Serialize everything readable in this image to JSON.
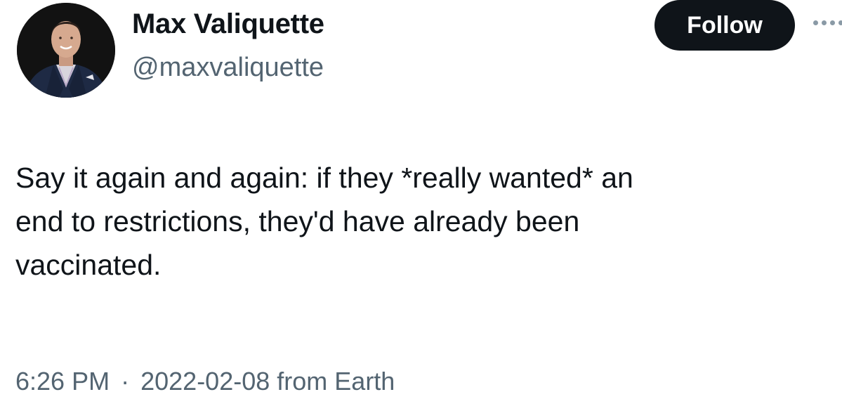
{
  "user": {
    "display_name": "Max Valiquette",
    "handle": "@maxvaliquette"
  },
  "actions": {
    "follow_label": "Follow",
    "more_icon": "more-horizontal-icon"
  },
  "tweet": {
    "text": "Say it again and again: if they *really wanted* an\nend to restrictions, they'd have already been\nvaccinated.",
    "time": "6:26 PM",
    "separator": "·",
    "date": "2022-02-08",
    "source": "from Earth"
  },
  "colors": {
    "text_primary": "#0f1419",
    "text_secondary": "#536471",
    "follow_bg": "#0f1419",
    "follow_text": "#ffffff"
  }
}
